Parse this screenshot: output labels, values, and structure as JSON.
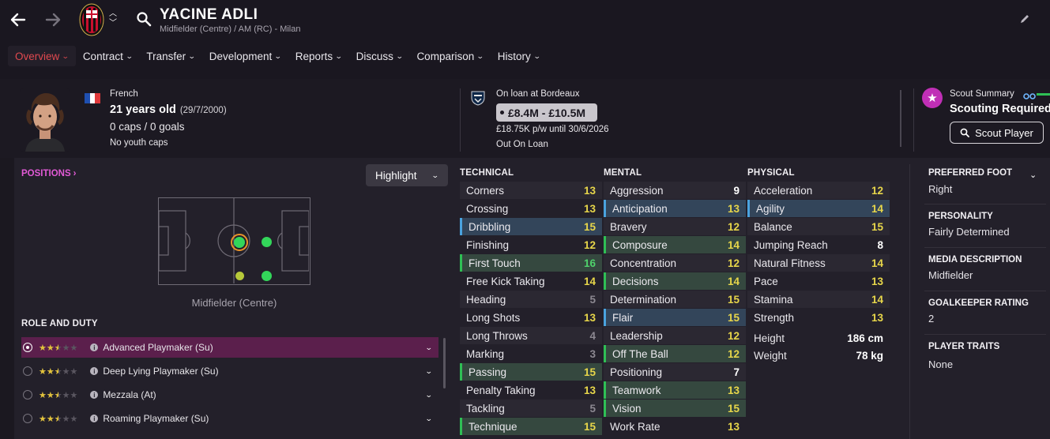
{
  "player": {
    "name": "YACINE ADLI",
    "subtitle": "Midfielder (Centre) / AM (RC) - Milan"
  },
  "menu": [
    {
      "label": "Overview",
      "active": true
    },
    {
      "label": "Contract"
    },
    {
      "label": "Transfer"
    },
    {
      "label": "Development"
    },
    {
      "label": "Reports"
    },
    {
      "label": "Discuss"
    },
    {
      "label": "Comparison"
    },
    {
      "label": "History"
    }
  ],
  "profile": {
    "nationality": "French",
    "age": "21 years old",
    "dob": "(29/7/2000)",
    "caps": "0 caps / 0 goals",
    "youth": "No youth caps"
  },
  "loan": {
    "status": "On loan at Bordeaux",
    "value": "£8.4M - £10.5M",
    "wage": "£18.75K p/w until 30/6/2026",
    "footer": "Out On Loan"
  },
  "scout": {
    "summary": "Scout Summary",
    "required": "Scouting Required",
    "button": "Scout Player"
  },
  "positions": {
    "title": "POSITIONS",
    "highlight": "Highlight",
    "label": "Midfielder (Centre)"
  },
  "roles": {
    "title": "ROLE AND DUTY",
    "items": [
      {
        "name": "Advanced Playmaker (Su)",
        "stars": 2.5,
        "selected": true
      },
      {
        "name": "Deep Lying Playmaker (Su)",
        "stars": 2.5
      },
      {
        "name": "Mezzala (At)",
        "stars": 2.5
      },
      {
        "name": "Roaming Playmaker (Su)",
        "stars": 2.5
      }
    ]
  },
  "technical": {
    "title": "TECHNICAL",
    "items": [
      {
        "name": "Corners",
        "value": "13"
      },
      {
        "name": "Crossing",
        "value": "13"
      },
      {
        "name": "Dribbling",
        "value": "15"
      },
      {
        "name": "Finishing",
        "value": "12"
      },
      {
        "name": "First Touch",
        "value": "16"
      },
      {
        "name": "Free Kick Taking",
        "value": "14"
      },
      {
        "name": "Heading",
        "value": "5"
      },
      {
        "name": "Long Shots",
        "value": "13"
      },
      {
        "name": "Long Throws",
        "value": "4"
      },
      {
        "name": "Marking",
        "value": "3"
      },
      {
        "name": "Passing",
        "value": "15"
      },
      {
        "name": "Penalty Taking",
        "value": "13"
      },
      {
        "name": "Tackling",
        "value": "5"
      },
      {
        "name": "Technique",
        "value": "15"
      }
    ]
  },
  "mental": {
    "title": "MENTAL",
    "items": [
      {
        "name": "Aggression",
        "value": "9"
      },
      {
        "name": "Anticipation",
        "value": "13"
      },
      {
        "name": "Bravery",
        "value": "12"
      },
      {
        "name": "Composure",
        "value": "14"
      },
      {
        "name": "Concentration",
        "value": "12"
      },
      {
        "name": "Decisions",
        "value": "14"
      },
      {
        "name": "Determination",
        "value": "15"
      },
      {
        "name": "Flair",
        "value": "15"
      },
      {
        "name": "Leadership",
        "value": "12"
      },
      {
        "name": "Off The Ball",
        "value": "12"
      },
      {
        "name": "Positioning",
        "value": "7"
      },
      {
        "name": "Teamwork",
        "value": "13"
      },
      {
        "name": "Vision",
        "value": "15"
      },
      {
        "name": "Work Rate",
        "value": "13"
      }
    ]
  },
  "physical": {
    "title": "PHYSICAL",
    "items": [
      {
        "name": "Acceleration",
        "value": "12"
      },
      {
        "name": "Agility",
        "value": "14"
      },
      {
        "name": "Balance",
        "value": "15"
      },
      {
        "name": "Jumping Reach",
        "value": "8"
      },
      {
        "name": "Natural Fitness",
        "value": "14"
      },
      {
        "name": "Pace",
        "value": "13"
      },
      {
        "name": "Stamina",
        "value": "14"
      },
      {
        "name": "Strength",
        "value": "13"
      }
    ],
    "height_label": "Height",
    "height": "186 cm",
    "weight_label": "Weight",
    "weight": "78 kg"
  },
  "info": {
    "foot_title": "PREFERRED FOOT",
    "foot": "Right",
    "personality_title": "PERSONALITY",
    "personality": "Fairly Determined",
    "media_title": "MEDIA DESCRIPTION",
    "media": "Midfielder",
    "gk_title": "GOALKEEPER RATING",
    "gk": "2",
    "traits_title": "PLAYER TRAITS",
    "traits": "None"
  },
  "colors": {
    "accent_red": "#e0494f",
    "value_yellow": "#e7d64a",
    "value_green": "#4fd16b",
    "value_white": "#ffffff",
    "value_grey": "#8c8891",
    "positions_pink": "#e25ad6",
    "role_selected": "#5b1f4c"
  }
}
